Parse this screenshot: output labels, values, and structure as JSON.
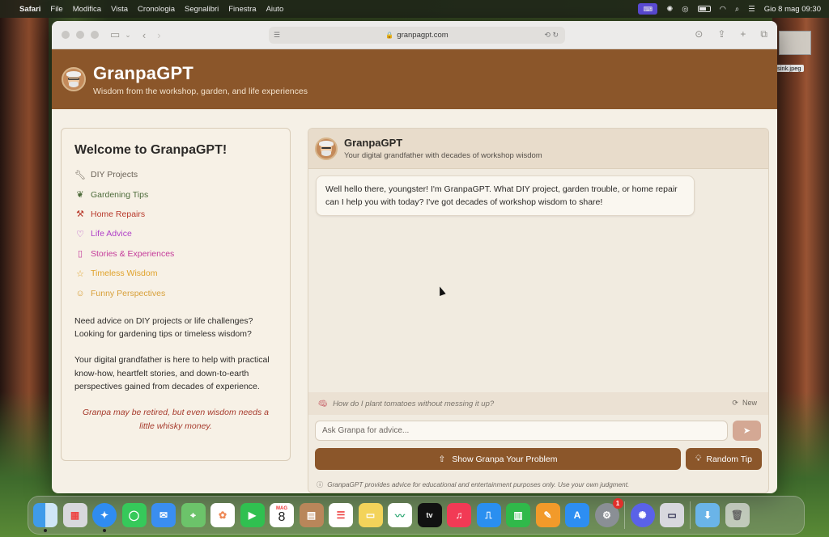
{
  "menubar": {
    "apple": "",
    "app": "Safari",
    "items": [
      "File",
      "Modifica",
      "Vista",
      "Cronologia",
      "Segnalibri",
      "Finestra",
      "Aiuto"
    ],
    "datetime": "Gio 8 mag  09:30"
  },
  "desktop": {
    "file_label": "sink.jpeg"
  },
  "browser": {
    "url": "granpagpt.com"
  },
  "header": {
    "title": "GranpaGPT",
    "subtitle": "Wisdom from the workshop, garden, and life experiences"
  },
  "left": {
    "title": "Welcome to GranpaGPT!",
    "items": [
      {
        "label": "DIY Projects",
        "icon": "wrench-icon",
        "color": "#6b6358"
      },
      {
        "label": "Gardening Tips",
        "icon": "leaf-icon",
        "color": "#4d6b3a"
      },
      {
        "label": "Home Repairs",
        "icon": "hammer-icon",
        "color": "#b8392b"
      },
      {
        "label": "Life Advice",
        "icon": "heart-icon",
        "color": "#b040c8"
      },
      {
        "label": "Stories & Experiences",
        "icon": "book-icon",
        "color": "#c43a9a"
      },
      {
        "label": "Timeless Wisdom",
        "icon": "star-icon",
        "color": "#e0a22a"
      },
      {
        "label": "Funny Perspectives",
        "icon": "smile-icon",
        "color": "#d8a03a"
      }
    ],
    "para1": "Need advice on DIY projects or life challenges? Looking for gardening tips or timeless wisdom?",
    "para2": "Your digital grandfather is here to help with practical know-how, heartfelt stories, and down-to-earth perspectives gained from decades of experience.",
    "quote": "Granpa may be retired, but even wisdom needs a little whisky money."
  },
  "chat": {
    "title": "GranpaGPT",
    "subtitle": "Your digital grandfather with decades of workshop wisdom",
    "message": "Well hello there, youngster! I'm GranpaGPT. What DIY project, garden trouble, or home repair can I help you with today? I've got decades of workshop wisdom to share!",
    "suggestion": "How do I plant tomatoes without messing it up?",
    "new_label": "New",
    "input_placeholder": "Ask Granpa for advice...",
    "show_button": "Show Granpa Your Problem",
    "tip_button": "Random Tip",
    "disclaimer": "GranpaGPT provides advice for educational and entertainment purposes only. Use your own judgment."
  },
  "dock": {
    "calendar_month": "MAG",
    "calendar_day": "8",
    "tv_label": "tv",
    "settings_badge": "1"
  }
}
